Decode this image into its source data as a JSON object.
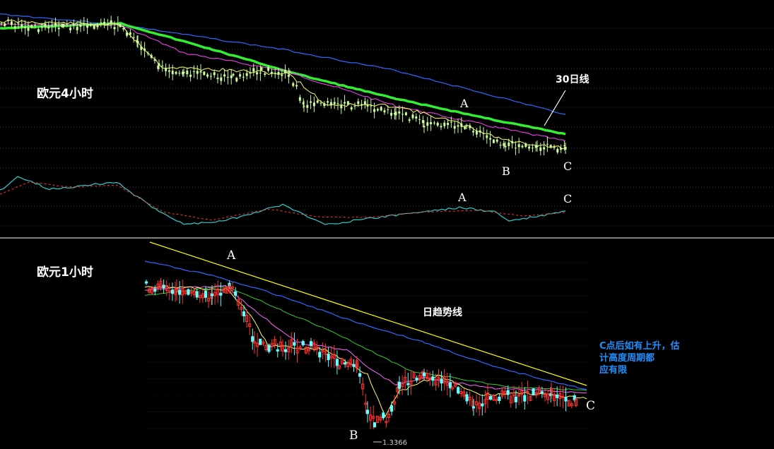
{
  "chart_data": [
    {
      "type": "candlestick",
      "title": "欧元4小时",
      "colors": {
        "background": "#000000",
        "grid": "#3a3a3a",
        "candle": "#ccff99",
        "ma_fast": "#ffff66",
        "ma_mid": "#ff44ff",
        "ma_30": "#33ee33",
        "ma_long": "#3366ff",
        "osc_main": "#33cccc",
        "osc_signal": "#ff3333"
      },
      "trend_label": "30日线",
      "point_labels": {
        "A": "A",
        "B": "B",
        "C": "C"
      },
      "oscillator_labels": {
        "A": "A",
        "C": "C"
      }
    },
    {
      "type": "candlestick",
      "title": "欧元1小时",
      "colors": {
        "background": "#000000",
        "grid": "#3a1a1a",
        "candle_up": "#ff3333",
        "candle_down": "#66ffff",
        "ma_fast": "#ffff66",
        "ma_mid": "#ff66ff",
        "ma_slow": "#33cc33",
        "ma_long": "#3366ff",
        "trendline": "#ffff00"
      },
      "trend_label": "日趋势线",
      "point_labels": {
        "A": "A",
        "B": "B",
        "C": "C"
      },
      "low_price": "1.3366",
      "note_lines": [
        "C点后如有上升，估",
        "计高度周期都",
        "应有限"
      ]
    }
  ]
}
